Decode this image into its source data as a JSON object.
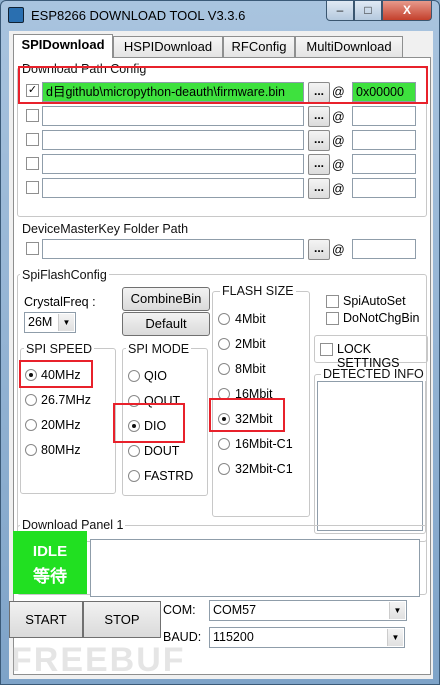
{
  "window": {
    "title": "ESP8266 DOWNLOAD TOOL V3.3.6",
    "min_glyph": "‒",
    "max_glyph": "□",
    "close_glyph": "X"
  },
  "tabs": [
    "SPIDownload",
    "HSPIDownload",
    "RFConfig",
    "MultiDownload"
  ],
  "download_path": {
    "group_label": "Download Path Config",
    "rows": [
      {
        "checked": true,
        "path": "d目github\\micropython-deauth\\firmware.bin",
        "address": "0x00000"
      },
      {
        "checked": false,
        "path": "",
        "address": ""
      },
      {
        "checked": false,
        "path": "",
        "address": ""
      },
      {
        "checked": false,
        "path": "",
        "address": ""
      },
      {
        "checked": false,
        "path": "",
        "address": ""
      }
    ],
    "browse_label": "...",
    "at_label": "@"
  },
  "device_key": {
    "label": "DeviceMasterKey Folder Path",
    "path": "",
    "address": "",
    "checked": false
  },
  "spi_flash": {
    "group_label": "SpiFlashConfig",
    "crystal_label": "CrystalFreq :",
    "crystal_value": "26M",
    "combine_label": "CombineBin",
    "default_label": "Default",
    "spi_speed": {
      "label": "SPI SPEED",
      "options": [
        "40MHz",
        "26.7MHz",
        "20MHz",
        "80MHz"
      ],
      "selected": "40MHz"
    },
    "spi_mode": {
      "label": "SPI MODE",
      "options": [
        "QIO",
        "QOUT",
        "DIO",
        "DOUT",
        "FASTRD"
      ],
      "selected": "DIO"
    },
    "flash_size": {
      "label": "FLASH SIZE",
      "options": [
        "4Mbit",
        "2Mbit",
        "8Mbit",
        "16Mbit",
        "32Mbit",
        "16Mbit-C1",
        "32Mbit-C1"
      ],
      "selected": "32Mbit"
    },
    "spi_auto_set": "SpiAutoSet",
    "do_not_chg_bin": "DoNotChgBin",
    "lock_settings": "LOCK SETTINGS",
    "detected_info": "DETECTED INFO"
  },
  "download_panel": {
    "label": "Download Panel 1",
    "status_en": "IDLE",
    "status_cn": "等待",
    "start_label": "START",
    "stop_label": "STOP",
    "com_label": "COM:",
    "com_value": "COM57",
    "baud_label": "BAUD:",
    "baud_value": "115200"
  },
  "watermark": "FREEBUF",
  "colors": {
    "status_green": "#21e021",
    "path_green": "#3ee13e",
    "highlight_red": "#e8212b"
  }
}
